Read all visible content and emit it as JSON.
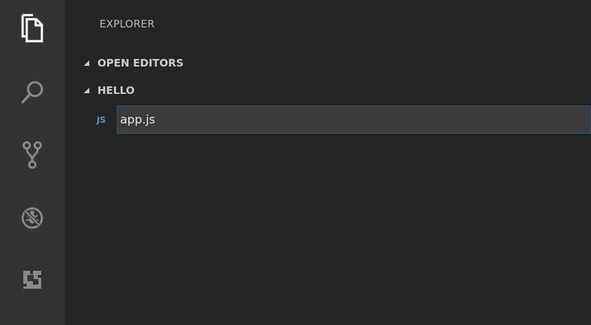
{
  "sidebar": {
    "title": "EXPLORER",
    "sections": [
      {
        "label": "OPEN EDITORS",
        "expanded": true
      },
      {
        "label": "HELLO",
        "expanded": true
      }
    ],
    "files": [
      {
        "icon_label": "JS",
        "name": "app.js",
        "renaming": true
      }
    ]
  },
  "activity_bar": {
    "items": [
      {
        "icon": "files-icon",
        "active": true
      },
      {
        "icon": "search-icon",
        "active": false
      },
      {
        "icon": "source-control-icon",
        "active": false
      },
      {
        "icon": "debug-icon",
        "active": false
      },
      {
        "icon": "extensions-icon",
        "active": false
      }
    ]
  },
  "colors": {
    "activity_bar_bg": "#333333",
    "sidebar_bg": "#252526",
    "js_icon": "#519aba",
    "input_border": "#1f5f8c",
    "input_bg": "#3c3c3c"
  }
}
